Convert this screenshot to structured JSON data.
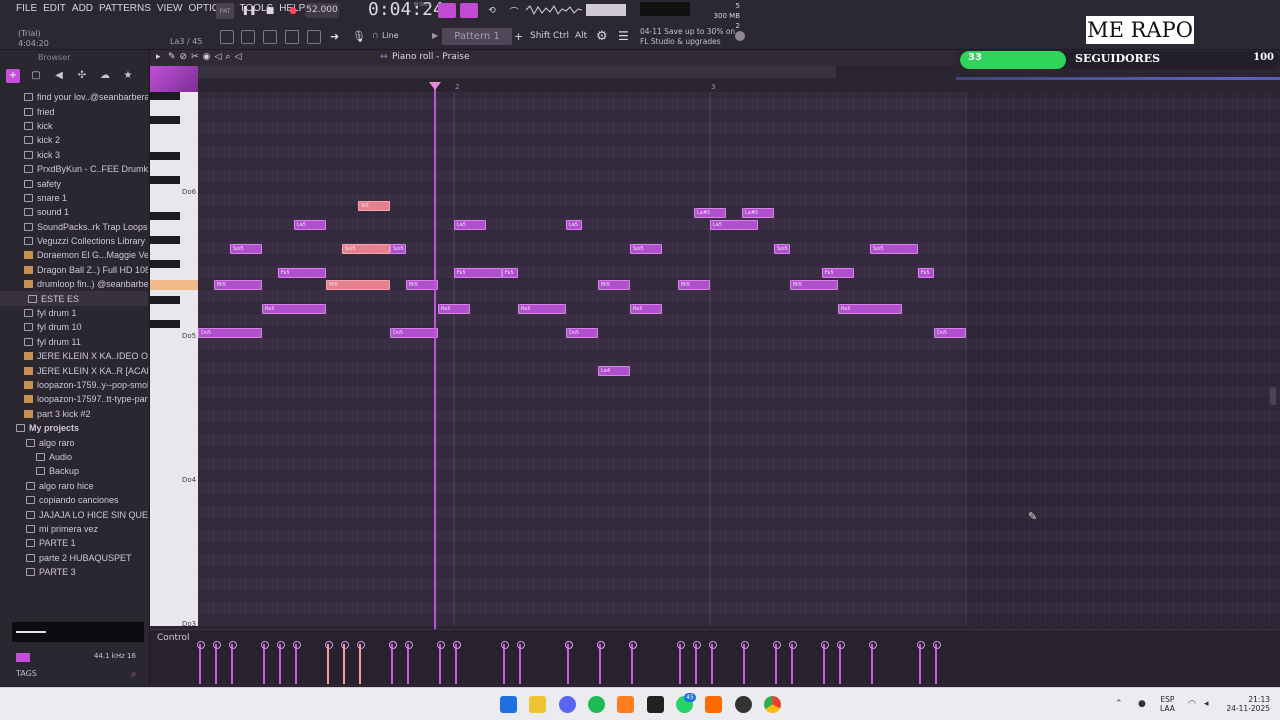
{
  "menu": [
    "FILE",
    "EDIT",
    "ADD",
    "PATTERNS",
    "VIEW",
    "OPTIONS",
    "TOOLS",
    "HELP"
  ],
  "status": {
    "trial": "(Trial)",
    "position": "4:04:20",
    "note_readout": "La3 / 45"
  },
  "transport": {
    "tempo": "52.000",
    "time": "0:04:24",
    "time_unit": "M:S:CS"
  },
  "system": {
    "cpu": "5",
    "memory": "300 MB",
    "voices": "2"
  },
  "pattern": {
    "label": "Pattern 1",
    "snap": "Line",
    "keys": [
      "Shift",
      "Ctrl",
      "Alt"
    ]
  },
  "hint": {
    "line1": "04-11  Save up to 30% on",
    "line2": "FL Studio & upgrades"
  },
  "overlay": {
    "title": "ME RAPO",
    "followers_count": "33",
    "followers_label": "SEGUIDORES",
    "followers_goal": "100",
    "followers_progress": 0.33
  },
  "browser": {
    "header": "Browser",
    "items": [
      {
        "label": "find your lov..@seanbarbera",
        "type": "folder",
        "indent": 24
      },
      {
        "label": "fried",
        "type": "folder",
        "indent": 24
      },
      {
        "label": "kick",
        "type": "folder",
        "indent": 24
      },
      {
        "label": "kick 2",
        "type": "folder",
        "indent": 24
      },
      {
        "label": "kick 3",
        "type": "folder",
        "indent": 24
      },
      {
        "label": "PrxdByKun - C..FEE Drumkit",
        "type": "folder",
        "indent": 24
      },
      {
        "label": "safety",
        "type": "folder",
        "indent": 24
      },
      {
        "label": "snare 1",
        "type": "folder",
        "indent": 24
      },
      {
        "label": "sound 1",
        "type": "folder",
        "indent": 24
      },
      {
        "label": "SoundPacks..rk Trap Loops",
        "type": "folder",
        "indent": 24
      },
      {
        "label": "Veguzzi Collections Library",
        "type": "folder",
        "indent": 24
      },
      {
        "label": "Doraemon El G...Maggie Vera",
        "type": "audio",
        "indent": 24
      },
      {
        "label": "Dragon Ball Z..) Full HD 1080p",
        "type": "audio",
        "indent": 24
      },
      {
        "label": "drumloop fin..) @seanbarbera",
        "type": "audio",
        "indent": 24
      },
      {
        "label": "ESTE ES",
        "type": "plain",
        "indent": 28
      },
      {
        "label": "fyl drum 1",
        "type": "folder",
        "indent": 24
      },
      {
        "label": "fyl drum 10",
        "type": "folder",
        "indent": 24
      },
      {
        "label": "fyl drum 11",
        "type": "folder",
        "indent": 24
      },
      {
        "label": "JERE KLEIN X KA..IDEO OFICIAL)",
        "type": "audio",
        "indent": 24
      },
      {
        "label": "JERE KLEIN X KA..R [ACAPELLA]",
        "type": "audio",
        "indent": 24
      },
      {
        "label": "loopazon-1759..y--pop-smoke",
        "type": "audio",
        "indent": 24
      },
      {
        "label": "loopazon-17597..tt-type-part-1",
        "type": "audio",
        "indent": 24
      },
      {
        "label": "part 3 kick #2",
        "type": "audio",
        "indent": 24
      },
      {
        "label": "My projects",
        "type": "folder",
        "indent": 16
      },
      {
        "label": "algo raro",
        "type": "folder",
        "indent": 26
      },
      {
        "label": "Audio",
        "type": "folder",
        "indent": 36
      },
      {
        "label": "Backup",
        "type": "folder",
        "indent": 36
      },
      {
        "label": "algo raro hice",
        "type": "folder",
        "indent": 26
      },
      {
        "label": "copiando canciones",
        "type": "folder",
        "indent": 26
      },
      {
        "label": "JAJAJA LO HICE SIN QUERER",
        "type": "folder",
        "indent": 26
      },
      {
        "label": "mi primera vez",
        "type": "folder",
        "indent": 26
      },
      {
        "label": "PARTE 1",
        "type": "folder",
        "indent": 26
      },
      {
        "label": "parte 2 HUBAQUSPET",
        "type": "folder",
        "indent": 26
      },
      {
        "label": "PARTE 3",
        "type": "folder",
        "indent": 26
      }
    ],
    "sample_rate": "44.1 kHz 16",
    "tags": "TAGS"
  },
  "piano_roll": {
    "title": "Piano roll - Praise",
    "control_label": "Control",
    "bars": [
      "2",
      "3"
    ],
    "octaves": [
      "Do6",
      "Do5",
      "Do4",
      "Do3"
    ],
    "notes": [
      {
        "name": "Sol5",
        "start": 230,
        "end": 262,
        "row": "Sol5"
      },
      {
        "name": "Mi5",
        "start": 214,
        "end": 262,
        "row": "Mi5"
      },
      {
        "name": "Do5",
        "start": 198,
        "end": 262,
        "row": "Do5"
      },
      {
        "name": "Re5",
        "start": 262,
        "end": 326,
        "row": "Re5"
      },
      {
        "name": "Fa5",
        "start": 278,
        "end": 326,
        "row": "Fa5"
      },
      {
        "name": "La5",
        "start": 294,
        "end": 326,
        "row": "La5"
      },
      {
        "name": "Mi5",
        "start": 326,
        "end": 390,
        "row": "Mi5",
        "selected": true
      },
      {
        "name": "Sol5",
        "start": 342,
        "end": 390,
        "row": "Sol5",
        "selected": true
      },
      {
        "name": "Si5",
        "start": 358,
        "end": 390,
        "row": "Si5",
        "selected": true
      },
      {
        "name": "Sol5",
        "start": 390,
        "end": 406,
        "row": "Sol5"
      },
      {
        "name": "Do5",
        "start": 390,
        "end": 438,
        "row": "Do5"
      },
      {
        "name": "Mi5",
        "start": 406,
        "end": 438,
        "row": "Mi5"
      },
      {
        "name": "Re5",
        "start": 438,
        "end": 470,
        "row": "Re5"
      },
      {
        "name": "Fa5",
        "start": 454,
        "end": 502,
        "row": "Fa5"
      },
      {
        "name": "La5",
        "start": 454,
        "end": 486,
        "row": "La5"
      },
      {
        "name": "Fa5",
        "start": 502,
        "end": 518,
        "row": "Fa5"
      },
      {
        "name": "Re5",
        "start": 518,
        "end": 566,
        "row": "Re5"
      },
      {
        "name": "Do5",
        "start": 566,
        "end": 598,
        "row": "Do5"
      },
      {
        "name": "La5",
        "start": 566,
        "end": 582,
        "row": "La5"
      },
      {
        "name": "Mi5",
        "start": 598,
        "end": 630,
        "row": "Mi5"
      },
      {
        "name": "La4",
        "start": 598,
        "end": 630,
        "row": "La4"
      },
      {
        "name": "Re5",
        "start": 630,
        "end": 662,
        "row": "Re5"
      },
      {
        "name": "Sol5",
        "start": 630,
        "end": 662,
        "row": "Sol5"
      },
      {
        "name": "Mi5",
        "start": 678,
        "end": 710,
        "row": "Mi5"
      },
      {
        "name": "La#5",
        "start": 694,
        "end": 726,
        "row": "La#5"
      },
      {
        "name": "La5",
        "start": 710,
        "end": 758,
        "row": "La5"
      },
      {
        "name": "La#5",
        "start": 742,
        "end": 774,
        "row": "La#5"
      },
      {
        "name": "Sol5",
        "start": 774,
        "end": 790,
        "row": "Sol5"
      },
      {
        "name": "Mi5",
        "start": 790,
        "end": 838,
        "row": "Mi5"
      },
      {
        "name": "Fa5",
        "start": 822,
        "end": 854,
        "row": "Fa5"
      },
      {
        "name": "Re5",
        "start": 838,
        "end": 902,
        "row": "Re5"
      },
      {
        "name": "Sol5",
        "start": 870,
        "end": 918,
        "row": "Sol5"
      },
      {
        "name": "Fa5",
        "start": 918,
        "end": 934,
        "row": "Fa5"
      },
      {
        "name": "Do5",
        "start": 934,
        "end": 966,
        "row": "Do5"
      }
    ],
    "playhead": 434
  },
  "taskbar": {
    "lang1": "ESP",
    "lang2": "LAA",
    "time": "21:13",
    "date": "24-11-2025",
    "badge": "45"
  },
  "colors": {
    "note": "#b050cc",
    "note_selected": "#e7808e",
    "accent": "#c550e0",
    "followers": "#2fd55a"
  }
}
